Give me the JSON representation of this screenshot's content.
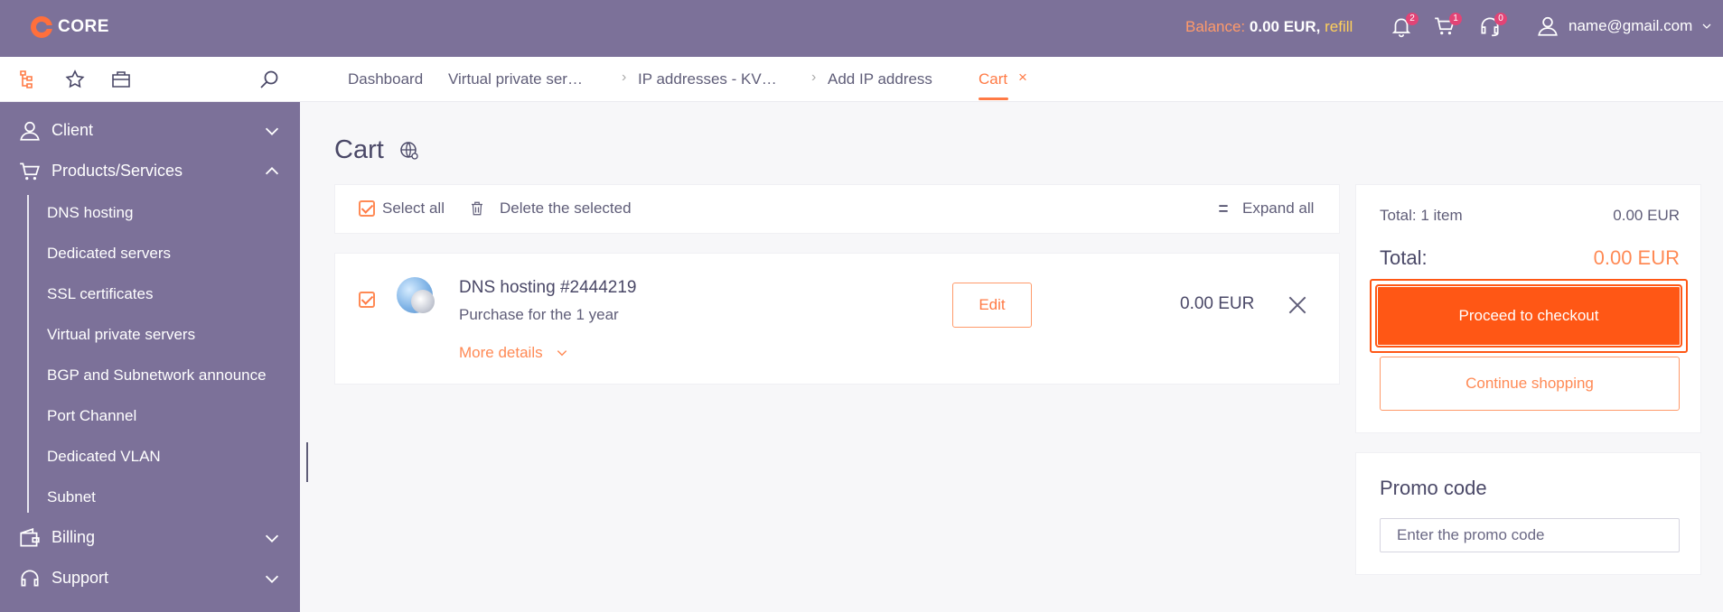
{
  "header": {
    "logo_text": "CORE",
    "balance_label": "Balance:",
    "balance_value": "0.00 EUR,",
    "refill_label": "refill",
    "notifications_count": "2",
    "cart_count": "1",
    "support_count": "0",
    "user_email": "name@gmail.com"
  },
  "breadcrumbs": [
    {
      "label": "Dashboard"
    },
    {
      "label": "Virtual private ser…"
    },
    {
      "label": "IP addresses - KV…"
    },
    {
      "label": "Add IP address"
    },
    {
      "label": "Cart"
    }
  ],
  "sidebar": {
    "items": [
      {
        "label": "Client",
        "icon": "client-icon"
      },
      {
        "label": "Products/Services",
        "icon": "cart-icon"
      },
      {
        "label": "Billing",
        "icon": "wallet-icon"
      },
      {
        "label": "Support",
        "icon": "headset-icon"
      }
    ],
    "sub_items": [
      {
        "label": "DNS hosting"
      },
      {
        "label": "Dedicated servers"
      },
      {
        "label": "SSL certificates"
      },
      {
        "label": "Virtual private servers"
      },
      {
        "label": "BGP and Subnetwork announce"
      },
      {
        "label": "Port Channel"
      },
      {
        "label": "Dedicated VLAN"
      },
      {
        "label": "Subnet"
      }
    ]
  },
  "main": {
    "title": "Cart",
    "toolbar": {
      "select_all": "Select all",
      "delete_selected": "Delete the selected",
      "expand_all": "Expand all"
    },
    "item": {
      "title": "DNS hosting #2444219",
      "subtitle": "Purchase for the 1 year",
      "more_details": "More details",
      "edit_label": "Edit",
      "price": "0.00 EUR"
    }
  },
  "summary": {
    "total_items_label": "Total: 1 item",
    "total_items_value": "0.00 EUR",
    "total_label": "Total:",
    "total_value": "0.00 EUR",
    "checkout_label": "Proceed to checkout",
    "continue_label": "Continue shopping"
  },
  "promo": {
    "title": "Promo code",
    "placeholder": "Enter the promo code"
  },
  "colors": {
    "header_bg": "#7c7199",
    "accent": "#ff5715",
    "accent_light": "#ff8a55"
  }
}
